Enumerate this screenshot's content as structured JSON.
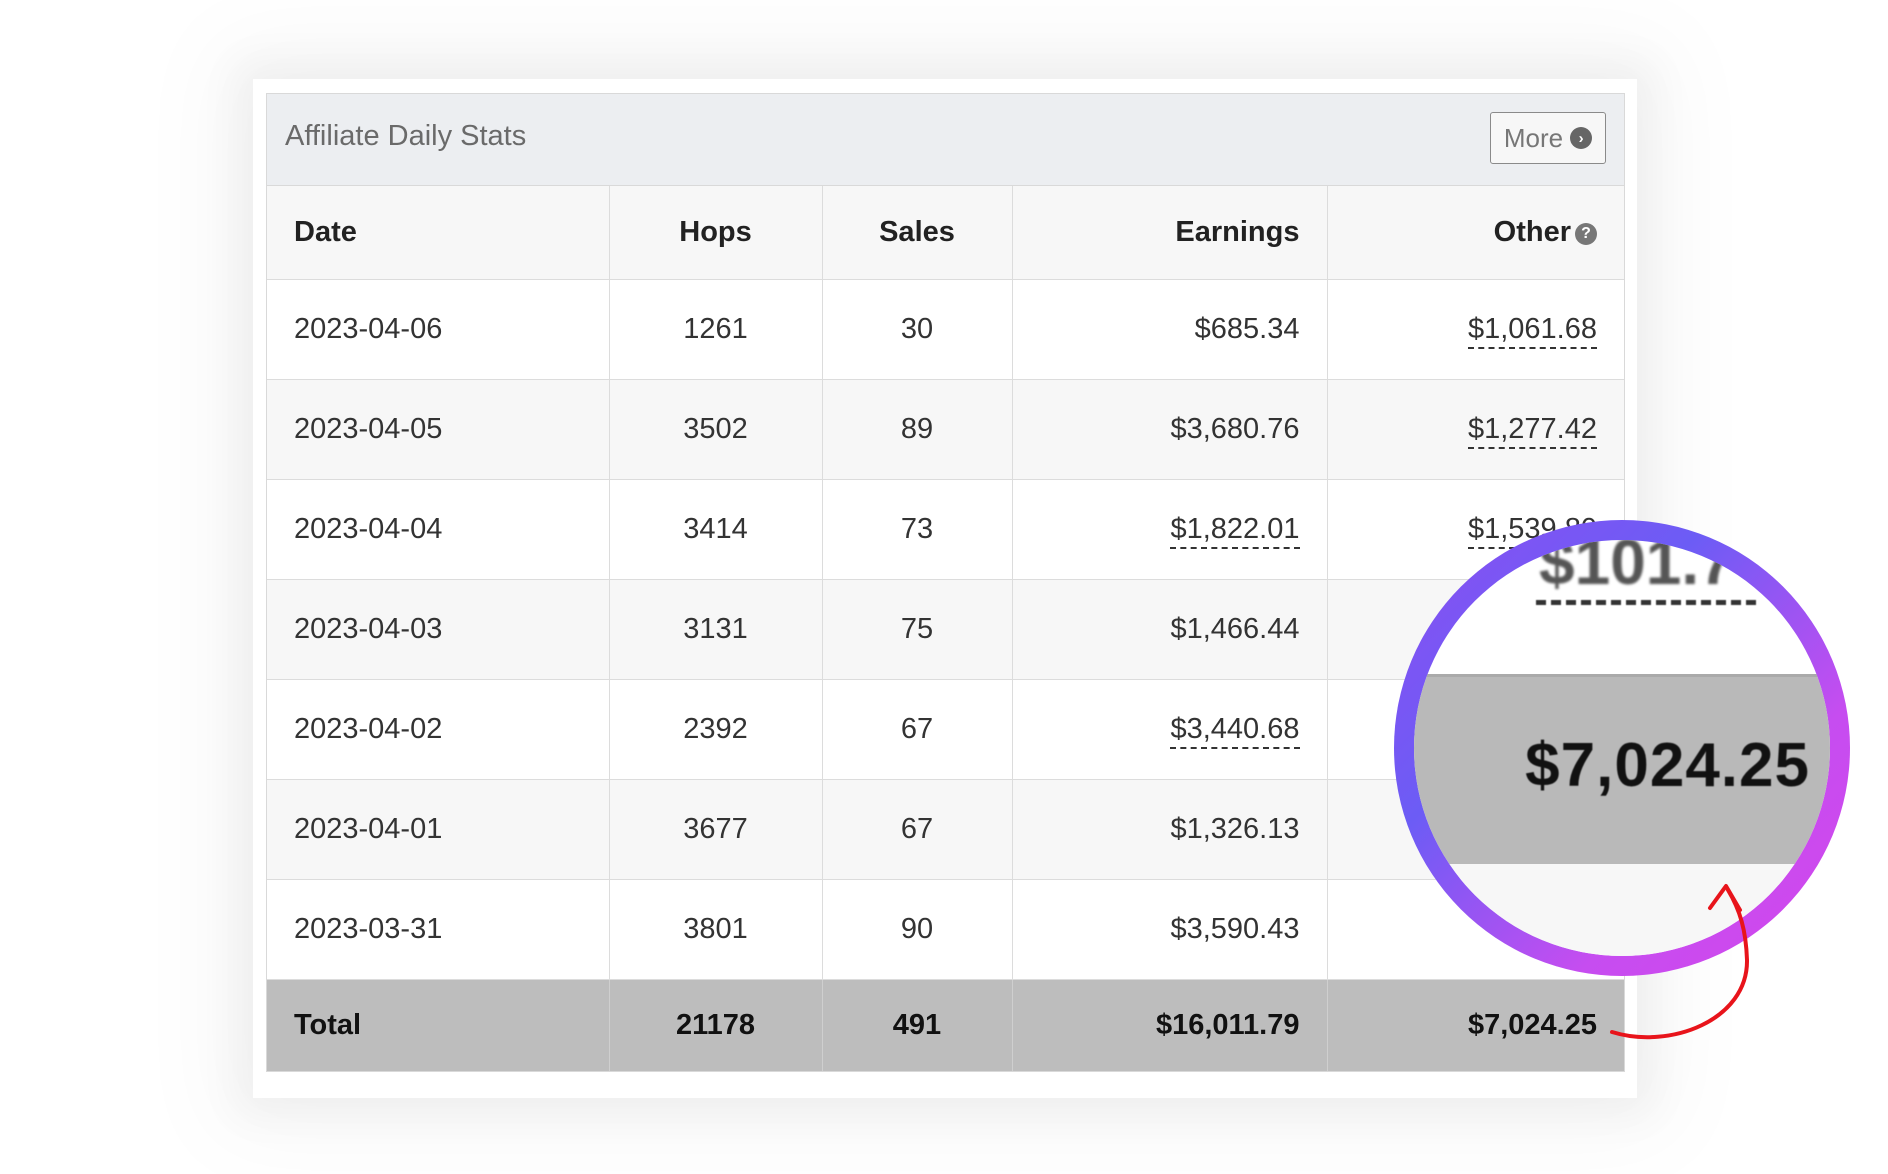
{
  "panel": {
    "title": "Affiliate Daily Stats",
    "more_label": "More",
    "more_icon": "chevron-right-circle-icon"
  },
  "table": {
    "columns": [
      "Date",
      "Hops",
      "Sales",
      "Earnings",
      "Other"
    ],
    "other_help_icon": "question-circle-icon",
    "rows": [
      {
        "date": "2023-04-06",
        "hops": "1261",
        "sales": "30",
        "earnings": "$685.34",
        "other": "$1,061.68"
      },
      {
        "date": "2023-04-05",
        "hops": "3502",
        "sales": "89",
        "earnings": "$3,680.76",
        "other": "$1,277.42"
      },
      {
        "date": "2023-04-04",
        "hops": "3414",
        "sales": "73",
        "earnings": "$1,822.01",
        "other": "$1,539.80"
      },
      {
        "date": "2023-04-03",
        "hops": "3131",
        "sales": "75",
        "earnings": "$1,466.44",
        "other": ""
      },
      {
        "date": "2023-04-02",
        "hops": "2392",
        "sales": "67",
        "earnings": "$3,440.68",
        "other": ""
      },
      {
        "date": "2023-04-01",
        "hops": "3677",
        "sales": "67",
        "earnings": "$1,326.13",
        "other": ""
      },
      {
        "date": "2023-03-31",
        "hops": "3801",
        "sales": "90",
        "earnings": "$3,590.43",
        "other": ""
      }
    ],
    "total": {
      "label": "Total",
      "hops": "21178",
      "sales": "491",
      "earnings": "$16,011.79",
      "other": "$7,024.25"
    }
  },
  "magnifier": {
    "previous_value_partial": "$101.7",
    "value": "$7,024.25"
  },
  "colors": {
    "header_bg": "#eceef1",
    "total_row_bg": "#bdbdbd",
    "magnifier_ring_start": "#8b4ff2",
    "magnifier_ring_end": "#d445ec",
    "arrow": "#e8141b"
  }
}
